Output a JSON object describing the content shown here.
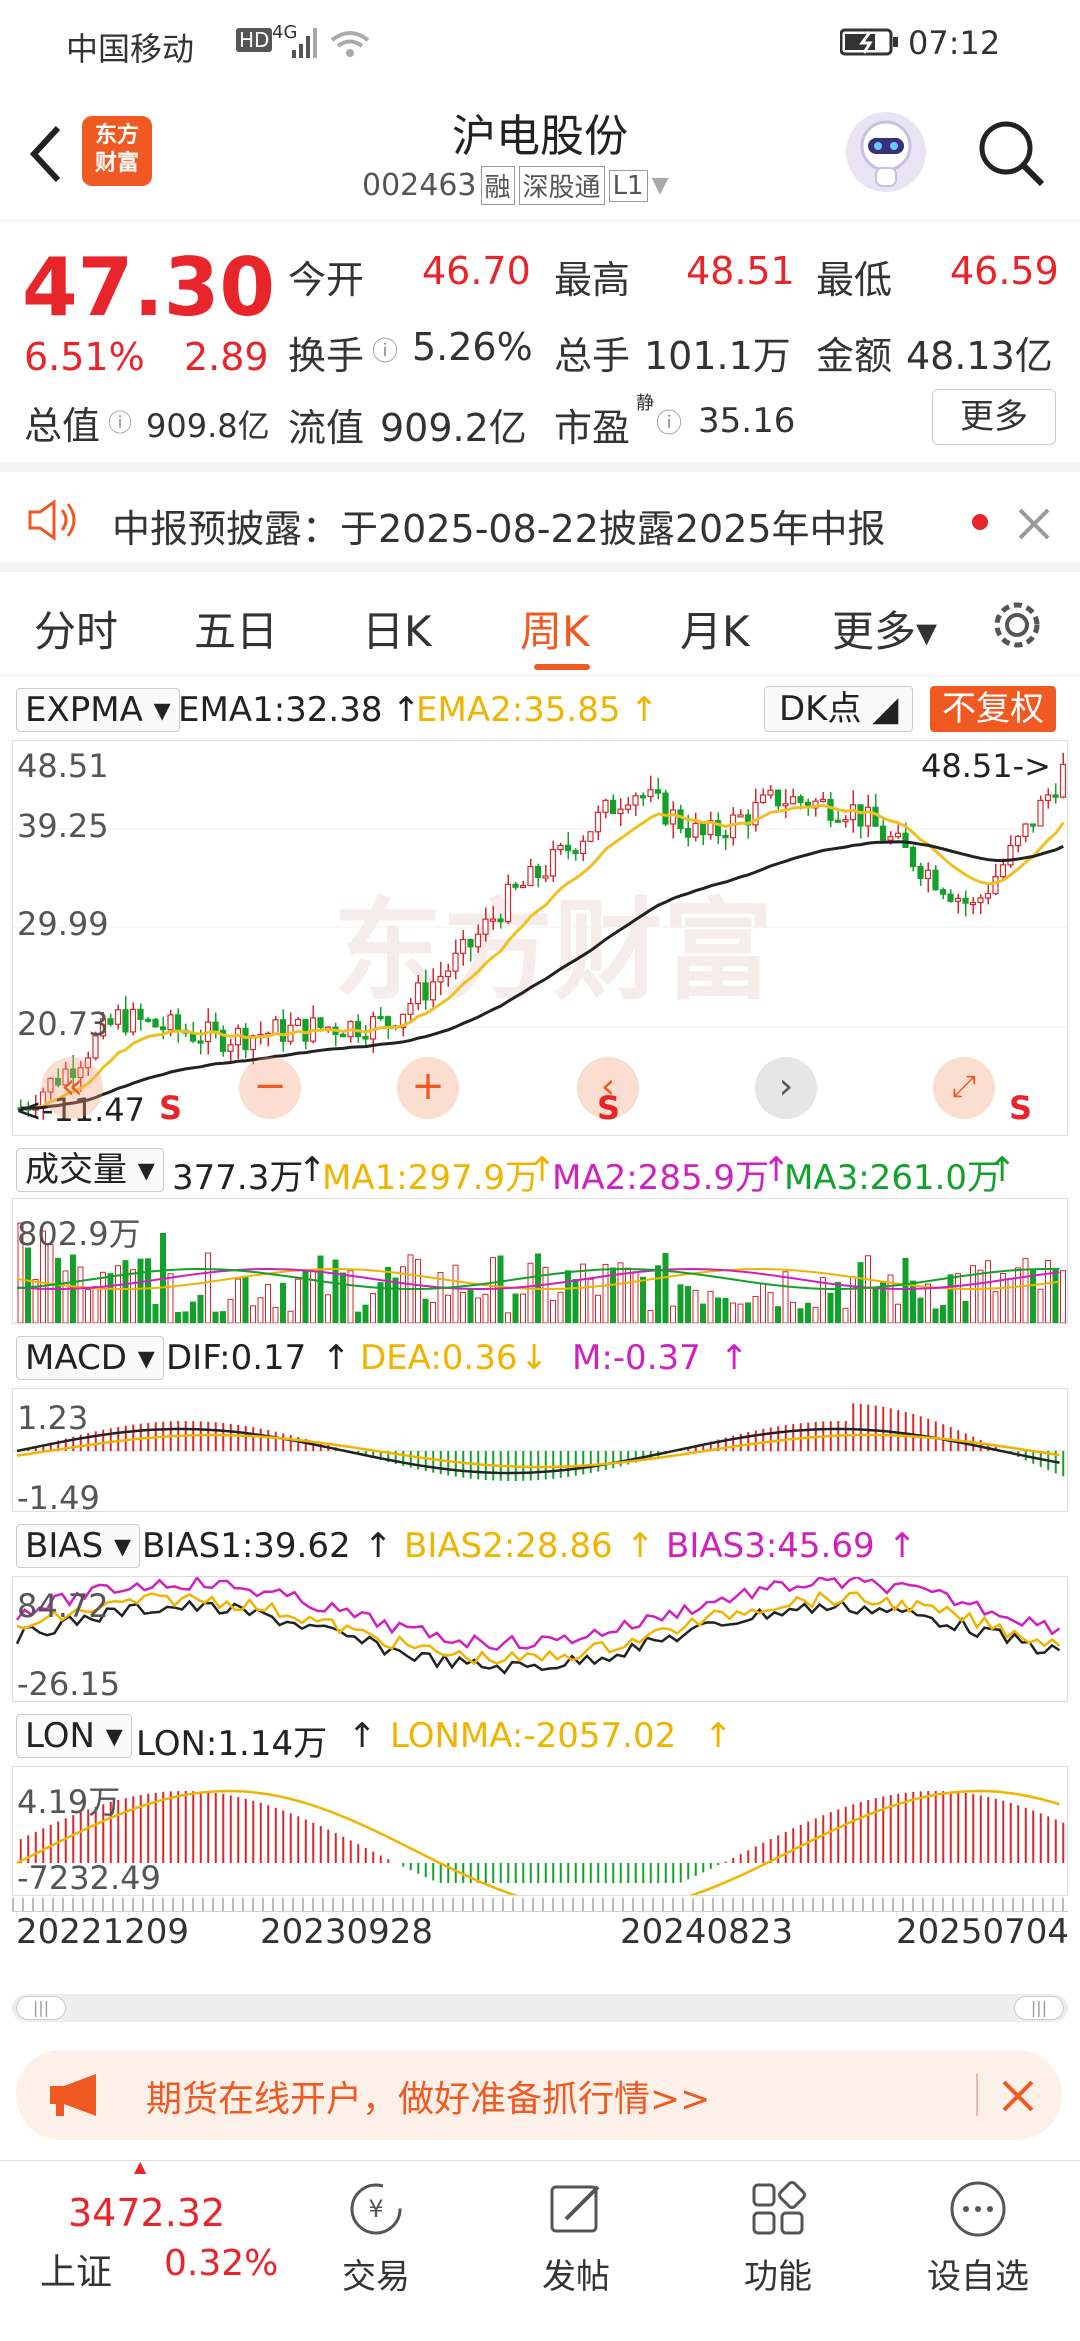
{
  "status_bar": {
    "carrier": "中国移动",
    "hd": "HD",
    "net": "4G",
    "time": "07:12"
  },
  "header": {
    "logo": "东方\n财富",
    "stock_name": "沪电股份",
    "code": "002463",
    "tags": [
      "融",
      "深股通",
      "L1"
    ]
  },
  "quote": {
    "price": "47.30",
    "change_pct": "6.51%",
    "change": "2.89",
    "open_label": "今开",
    "open": "46.70",
    "high_label": "最高",
    "high": "48.51",
    "low_label": "最低",
    "low": "46.59",
    "turnover_label": "换手",
    "turnover": "5.26%",
    "volume_label": "总手",
    "volume": "101.1万",
    "amount_label": "金额",
    "amount": "48.13亿",
    "mktcap_label": "总值",
    "mktcap": "909.8亿",
    "float_label": "流值",
    "float_cap": "909.2亿",
    "pe_label": "市盈",
    "pe_sup": "静",
    "pe": "35.16",
    "more": "更多"
  },
  "notice": {
    "text": "中报预披露：于2025-08-22披露2025年中报"
  },
  "tabs": [
    "分时",
    "五日",
    "日K",
    "周K",
    "月K",
    "更多▾"
  ],
  "active_tab": "周K",
  "kline": {
    "indicator": "EXPMA",
    "ema1": "EMA1:32.38",
    "ema2": "EMA2:35.85",
    "dk": "DK点",
    "adjust": "不复权",
    "y_labels": [
      "48.51",
      "39.25",
      "29.99",
      "20.73",
      "11.47"
    ],
    "max_marker": "48.51->",
    "min_marker": "<-11.47",
    "colors": {
      "ema1": "#222222",
      "ema2": "#f0c020",
      "up": "#d8262c",
      "down": "#12a12a"
    }
  },
  "volume": {
    "indicator": "成交量",
    "val": "377.3万",
    "ma1": "MA1:297.9万",
    "ma2": "MA2:285.9万",
    "ma3": "MA3:261.0万",
    "y_label": "802.9万"
  },
  "macd": {
    "indicator": "MACD",
    "dif": "DIF:0.17",
    "dea": "DEA:0.36",
    "m": "M:-0.37",
    "y_top": "1.23",
    "y_bottom": "-1.49"
  },
  "bias": {
    "indicator": "BIAS",
    "b1": "BIAS1:39.62",
    "b2": "BIAS2:28.86",
    "b3": "BIAS3:45.69",
    "y_top": "84.72",
    "y_bottom": "-26.15"
  },
  "lon": {
    "indicator": "LON",
    "lon": "LON:1.14万",
    "lonma": "LONMA:-2057.02",
    "y_top": "4.19万",
    "y_bottom": "-7232.49"
  },
  "dates": [
    "20221209",
    "20230928",
    "20240823",
    "20250704"
  ],
  "banner": {
    "text": "期货在线开户，做好准备抓行情>>"
  },
  "bottom_nav": {
    "index_name": "上证",
    "index_value": "3472.32",
    "index_change": "0.32%",
    "items": [
      "交易",
      "发帖",
      "功能",
      "设自选"
    ]
  }
}
